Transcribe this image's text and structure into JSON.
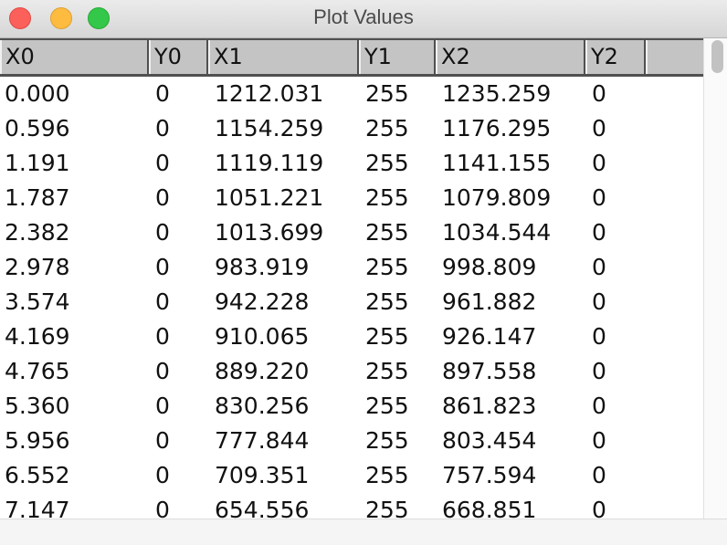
{
  "window": {
    "title": "Plot Values"
  },
  "table": {
    "columns": [
      "X0",
      "Y0",
      "X1",
      "Y1",
      "X2",
      "Y2"
    ],
    "rows": [
      [
        "0.000",
        "0",
        "1212.031",
        "255",
        "1235.259",
        "0"
      ],
      [
        "0.596",
        "0",
        "1154.259",
        "255",
        "1176.295",
        "0"
      ],
      [
        "1.191",
        "0",
        "1119.119",
        "255",
        "1141.155",
        "0"
      ],
      [
        "1.787",
        "0",
        "1051.221",
        "255",
        "1079.809",
        "0"
      ],
      [
        "2.382",
        "0",
        "1013.699",
        "255",
        "1034.544",
        "0"
      ],
      [
        "2.978",
        "0",
        "983.919",
        "255",
        "998.809",
        "0"
      ],
      [
        "3.574",
        "0",
        "942.228",
        "255",
        "961.882",
        "0"
      ],
      [
        "4.169",
        "0",
        "910.065",
        "255",
        "926.147",
        "0"
      ],
      [
        "4.765",
        "0",
        "889.220",
        "255",
        "897.558",
        "0"
      ],
      [
        "5.360",
        "0",
        "830.256",
        "255",
        "861.823",
        "0"
      ],
      [
        "5.956",
        "0",
        "777.844",
        "255",
        "803.454",
        "0"
      ],
      [
        "6.552",
        "0",
        "709.351",
        "255",
        "757.594",
        "0"
      ],
      [
        "7.147",
        "0",
        "654.556",
        "255",
        "668.851",
        "0"
      ]
    ]
  }
}
